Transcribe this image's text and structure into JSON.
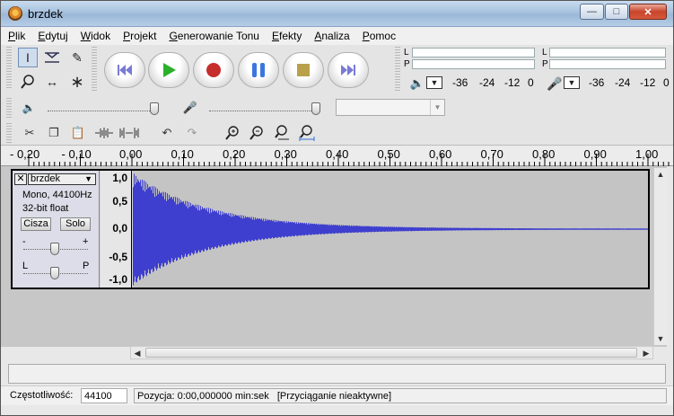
{
  "window": {
    "title": "brzdek"
  },
  "menu": [
    {
      "label": "Plik",
      "u": "P",
      "rest": "lik"
    },
    {
      "label": "Edytuj",
      "u": "E",
      "rest": "dytuj"
    },
    {
      "label": "Widok",
      "u": "W",
      "rest": "idok"
    },
    {
      "label": "Projekt",
      "u": "P",
      "rest": "rojekt"
    },
    {
      "label": "Generowanie Tonu",
      "u": "G",
      "rest": "enerowanie Tonu"
    },
    {
      "label": "Efekty",
      "u": "E",
      "rest": "fekty"
    },
    {
      "label": "Analiza",
      "u": "A",
      "rest": "naliza"
    },
    {
      "label": "Pomoc",
      "u": "P",
      "rest": "omoc"
    }
  ],
  "meters": {
    "play_l": "L",
    "play_r": "P",
    "rec_l": "L",
    "rec_r": "P",
    "play_ticks": [
      "-36",
      "-24",
      "-12",
      "0"
    ],
    "rec_ticks": [
      "-36",
      "-24",
      "-12",
      "0"
    ]
  },
  "ruler": {
    "labels": [
      "- 0,20",
      "- 0,10",
      "0,00",
      "0,10",
      "0,20",
      "0,30",
      "0,40",
      "0,50",
      "0,60",
      "0,70",
      "0,80",
      "0,90",
      "1,00"
    ]
  },
  "track": {
    "name": "brzdek",
    "format": "Mono, 44100Hz",
    "bits": "32-bit float",
    "mute": "Cisza",
    "solo": "Solo",
    "gain_minus": "-",
    "gain_plus": "+",
    "pan_l": "L",
    "pan_r": "P",
    "scale": [
      "1,0",
      "0,5",
      "0,0",
      "-0,5",
      "-1,0"
    ],
    "wave_color": "#3f3fcf"
  },
  "status": {
    "rate_label": "Częstotliwość:",
    "rate_value": "44100",
    "position": "Pozycja: 0:00,000000 min:sek",
    "snap": "[Przyciąganie nieaktywne]"
  }
}
